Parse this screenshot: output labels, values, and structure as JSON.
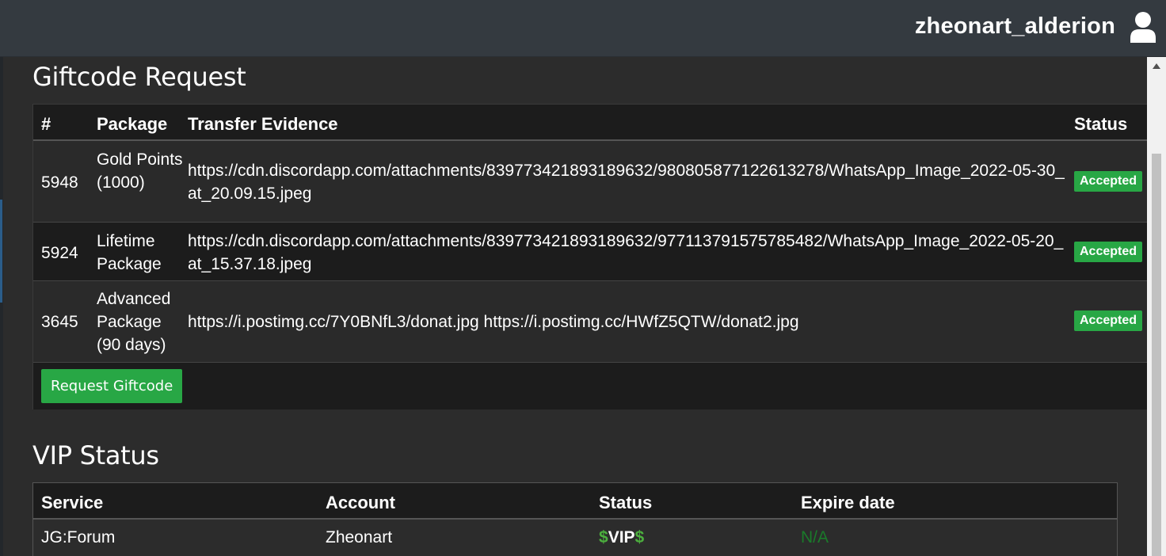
{
  "header": {
    "username": "zheonart_alderion",
    "user_icon": "user-icon"
  },
  "giftcode": {
    "title": "Giftcode Request",
    "columns": [
      "#",
      "Package",
      "Transfer Evidence",
      "Status"
    ],
    "rows": [
      {
        "id": "5948",
        "package": "Gold Points (1000)",
        "evidence": "https://cdn.discordapp.com/attachments/839773421893189632/980805877122613278/WhatsApp_Image_2022-05-30_at_20.09.15.jpeg",
        "status": "Accepted"
      },
      {
        "id": "5924",
        "package": "Lifetime Package",
        "evidence": "https://cdn.discordapp.com/attachments/839773421893189632/977113791575785482/WhatsApp_Image_2022-05-20_at_15.37.18.jpeg",
        "status": "Accepted"
      },
      {
        "id": "3645",
        "package": "Advanced Package (90 days)",
        "evidence": "https://i.postimg.cc/7Y0BNfL3/donat.jpg https://i.postimg.cc/HWfZ5QTW/donat2.jpg",
        "status": "Accepted"
      }
    ],
    "request_button": "Request Giftcode",
    "status_color": "#28a745"
  },
  "vip": {
    "title": "VIP Status",
    "columns": [
      "Service",
      "Account",
      "Status",
      "Expire date"
    ],
    "rows": [
      {
        "service": "JG:Forum",
        "account": "Zheonart",
        "status_prefix": "$",
        "status": "VIP",
        "status_suffix": "$",
        "expire": "N/A"
      }
    ]
  }
}
